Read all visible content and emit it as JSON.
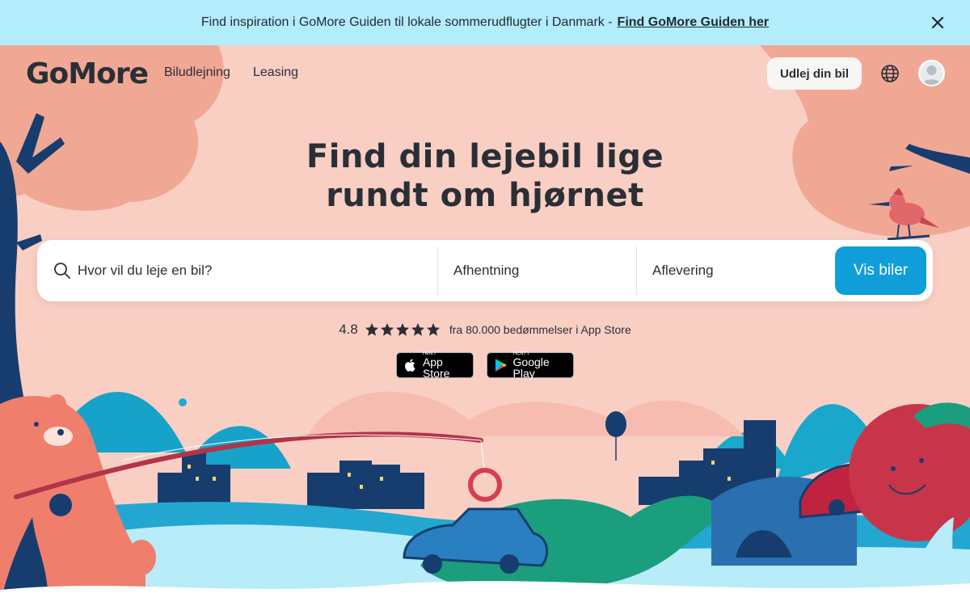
{
  "banner": {
    "text": "Find inspiration i GoMore Guiden til lokale sommerudflugter i Danmark -",
    "link": "Find GoMore Guiden her"
  },
  "nav": {
    "logo": "GoMore",
    "links": [
      "Biludlejning",
      "Leasing"
    ],
    "rent_button": "Udlej din bil"
  },
  "hero": {
    "headline_line1": "Find din lejebil lige",
    "headline_line2": "rundt om hjørnet"
  },
  "search": {
    "where_placeholder": "Hvor vil du leje en bil?",
    "pickup_label": "Afhentning",
    "dropoff_label": "Aflevering",
    "submit_label": "Vis biler"
  },
  "rating": {
    "score": "4.8",
    "stars": 5,
    "text": "fra 80.000 bedømmelser i App Store"
  },
  "badges": {
    "apple_small": "Hent i",
    "apple_big": "App Store",
    "google_small": "HENT I",
    "google_big": "Google Play"
  },
  "colors": {
    "banner_bg": "#b3ecfb",
    "hero_bg": "#f9cfc4",
    "primary_button": "#109ed9",
    "text_dark": "#2a2f36"
  }
}
